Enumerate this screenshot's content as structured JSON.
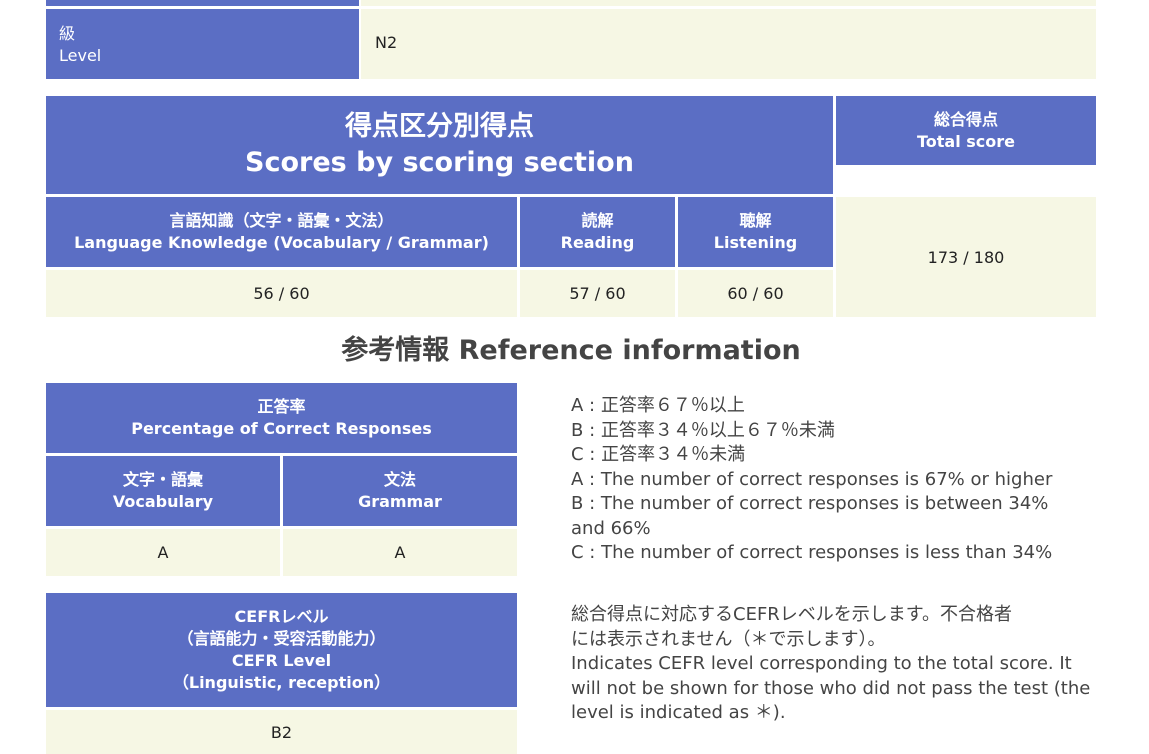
{
  "level": {
    "label_ja": "級",
    "label_en": "Level",
    "value": "N2"
  },
  "scores": {
    "title_ja": "得点区分別得点",
    "title_en": "Scores by scoring section",
    "total": {
      "label_ja": "総合得点",
      "label_en": "Total score",
      "value": "173 / 180"
    },
    "sections": [
      {
        "label_ja": "言語知識（文字・語彙・文法）",
        "label_en": "Language Knowledge (Vocabulary / Grammar)",
        "value": "56 / 60"
      },
      {
        "label_ja": "読解",
        "label_en": "Reading",
        "value": "57 / 60"
      },
      {
        "label_ja": "聴解",
        "label_en": "Listening",
        "value": "60 / 60"
      }
    ]
  },
  "reference": {
    "title": "参考情報 Reference information",
    "percentage": {
      "label_ja": "正答率",
      "label_en": "Percentage of Correct Responses",
      "columns": [
        {
          "label_ja": "文字・語彙",
          "label_en": "Vocabulary",
          "value": "A"
        },
        {
          "label_ja": "文法",
          "label_en": "Grammar",
          "value": "A"
        }
      ]
    },
    "grade_notes": [
      "A : 正答率６７％以上",
      "B : 正答率３４％以上６７％未満",
      "C : 正答率３４％未満",
      "A : The number of correct responses is 67% or higher",
      "B : The number of correct responses is between 34%",
      "and 66%",
      "C : The number of correct responses is less than 34%"
    ],
    "cefr": {
      "label_lines": [
        "CEFRレベル",
        "（言語能力・受容活動能力）",
        "CEFR Level",
        "（Linguistic, reception）"
      ],
      "value": "B2"
    },
    "cefr_notes": [
      "総合得点に対応するCEFRレベルを示します。不合格者",
      "には表示されません（＊で示します）。",
      "Indicates CEFR level corresponding to the total score. It",
      "will not be shown for those who did not pass the test (the",
      "level is indicated as ＊)."
    ]
  },
  "colors": {
    "header": "#5b6ec4",
    "cell": "#f6f7e4"
  }
}
